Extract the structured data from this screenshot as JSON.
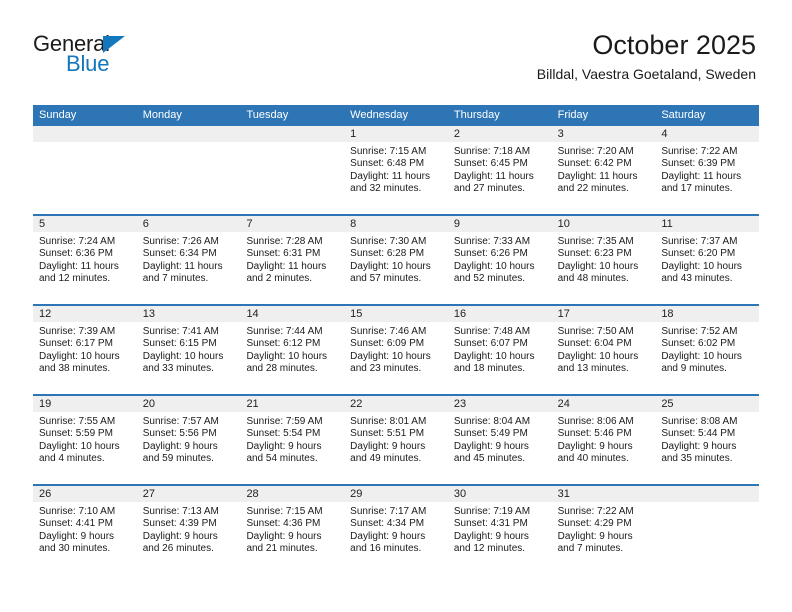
{
  "brand": {
    "word_one": "General",
    "word_two": "Blue",
    "accent_color": "#1277bc"
  },
  "header": {
    "title": "October 2025",
    "subtitle": "Billdal, Vaestra Goetaland, Sweden"
  },
  "theme": {
    "header_blue": "#2e75b6",
    "day_band_grey": "#efefef",
    "text_color": "#1b1b1b"
  },
  "weekday_headers": [
    "Sunday",
    "Monday",
    "Tuesday",
    "Wednesday",
    "Thursday",
    "Friday",
    "Saturday"
  ],
  "weeks": [
    [
      {
        "day": "",
        "lines": [
          "",
          "",
          "",
          ""
        ]
      },
      {
        "day": "",
        "lines": [
          "",
          "",
          "",
          ""
        ]
      },
      {
        "day": "",
        "lines": [
          "",
          "",
          "",
          ""
        ]
      },
      {
        "day": "1",
        "lines": [
          "Sunrise: 7:15 AM",
          "Sunset: 6:48 PM",
          "Daylight: 11 hours",
          "and 32 minutes."
        ]
      },
      {
        "day": "2",
        "lines": [
          "Sunrise: 7:18 AM",
          "Sunset: 6:45 PM",
          "Daylight: 11 hours",
          "and 27 minutes."
        ]
      },
      {
        "day": "3",
        "lines": [
          "Sunrise: 7:20 AM",
          "Sunset: 6:42 PM",
          "Daylight: 11 hours",
          "and 22 minutes."
        ]
      },
      {
        "day": "4",
        "lines": [
          "Sunrise: 7:22 AM",
          "Sunset: 6:39 PM",
          "Daylight: 11 hours",
          "and 17 minutes."
        ]
      }
    ],
    [
      {
        "day": "5",
        "lines": [
          "Sunrise: 7:24 AM",
          "Sunset: 6:36 PM",
          "Daylight: 11 hours",
          "and 12 minutes."
        ]
      },
      {
        "day": "6",
        "lines": [
          "Sunrise: 7:26 AM",
          "Sunset: 6:34 PM",
          "Daylight: 11 hours",
          "and 7 minutes."
        ]
      },
      {
        "day": "7",
        "lines": [
          "Sunrise: 7:28 AM",
          "Sunset: 6:31 PM",
          "Daylight: 11 hours",
          "and 2 minutes."
        ]
      },
      {
        "day": "8",
        "lines": [
          "Sunrise: 7:30 AM",
          "Sunset: 6:28 PM",
          "Daylight: 10 hours",
          "and 57 minutes."
        ]
      },
      {
        "day": "9",
        "lines": [
          "Sunrise: 7:33 AM",
          "Sunset: 6:26 PM",
          "Daylight: 10 hours",
          "and 52 minutes."
        ]
      },
      {
        "day": "10",
        "lines": [
          "Sunrise: 7:35 AM",
          "Sunset: 6:23 PM",
          "Daylight: 10 hours",
          "and 48 minutes."
        ]
      },
      {
        "day": "11",
        "lines": [
          "Sunrise: 7:37 AM",
          "Sunset: 6:20 PM",
          "Daylight: 10 hours",
          "and 43 minutes."
        ]
      }
    ],
    [
      {
        "day": "12",
        "lines": [
          "Sunrise: 7:39 AM",
          "Sunset: 6:17 PM",
          "Daylight: 10 hours",
          "and 38 minutes."
        ]
      },
      {
        "day": "13",
        "lines": [
          "Sunrise: 7:41 AM",
          "Sunset: 6:15 PM",
          "Daylight: 10 hours",
          "and 33 minutes."
        ]
      },
      {
        "day": "14",
        "lines": [
          "Sunrise: 7:44 AM",
          "Sunset: 6:12 PM",
          "Daylight: 10 hours",
          "and 28 minutes."
        ]
      },
      {
        "day": "15",
        "lines": [
          "Sunrise: 7:46 AM",
          "Sunset: 6:09 PM",
          "Daylight: 10 hours",
          "and 23 minutes."
        ]
      },
      {
        "day": "16",
        "lines": [
          "Sunrise: 7:48 AM",
          "Sunset: 6:07 PM",
          "Daylight: 10 hours",
          "and 18 minutes."
        ]
      },
      {
        "day": "17",
        "lines": [
          "Sunrise: 7:50 AM",
          "Sunset: 6:04 PM",
          "Daylight: 10 hours",
          "and 13 minutes."
        ]
      },
      {
        "day": "18",
        "lines": [
          "Sunrise: 7:52 AM",
          "Sunset: 6:02 PM",
          "Daylight: 10 hours",
          "and 9 minutes."
        ]
      }
    ],
    [
      {
        "day": "19",
        "lines": [
          "Sunrise: 7:55 AM",
          "Sunset: 5:59 PM",
          "Daylight: 10 hours",
          "and 4 minutes."
        ]
      },
      {
        "day": "20",
        "lines": [
          "Sunrise: 7:57 AM",
          "Sunset: 5:56 PM",
          "Daylight: 9 hours",
          "and 59 minutes."
        ]
      },
      {
        "day": "21",
        "lines": [
          "Sunrise: 7:59 AM",
          "Sunset: 5:54 PM",
          "Daylight: 9 hours",
          "and 54 minutes."
        ]
      },
      {
        "day": "22",
        "lines": [
          "Sunrise: 8:01 AM",
          "Sunset: 5:51 PM",
          "Daylight: 9 hours",
          "and 49 minutes."
        ]
      },
      {
        "day": "23",
        "lines": [
          "Sunrise: 8:04 AM",
          "Sunset: 5:49 PM",
          "Daylight: 9 hours",
          "and 45 minutes."
        ]
      },
      {
        "day": "24",
        "lines": [
          "Sunrise: 8:06 AM",
          "Sunset: 5:46 PM",
          "Daylight: 9 hours",
          "and 40 minutes."
        ]
      },
      {
        "day": "25",
        "lines": [
          "Sunrise: 8:08 AM",
          "Sunset: 5:44 PM",
          "Daylight: 9 hours",
          "and 35 minutes."
        ]
      }
    ],
    [
      {
        "day": "26",
        "lines": [
          "Sunrise: 7:10 AM",
          "Sunset: 4:41 PM",
          "Daylight: 9 hours",
          "and 30 minutes."
        ]
      },
      {
        "day": "27",
        "lines": [
          "Sunrise: 7:13 AM",
          "Sunset: 4:39 PM",
          "Daylight: 9 hours",
          "and 26 minutes."
        ]
      },
      {
        "day": "28",
        "lines": [
          "Sunrise: 7:15 AM",
          "Sunset: 4:36 PM",
          "Daylight: 9 hours",
          "and 21 minutes."
        ]
      },
      {
        "day": "29",
        "lines": [
          "Sunrise: 7:17 AM",
          "Sunset: 4:34 PM",
          "Daylight: 9 hours",
          "and 16 minutes."
        ]
      },
      {
        "day": "30",
        "lines": [
          "Sunrise: 7:19 AM",
          "Sunset: 4:31 PM",
          "Daylight: 9 hours",
          "and 12 minutes."
        ]
      },
      {
        "day": "31",
        "lines": [
          "Sunrise: 7:22 AM",
          "Sunset: 4:29 PM",
          "Daylight: 9 hours",
          "and 7 minutes."
        ]
      },
      {
        "day": "",
        "lines": [
          "",
          "",
          "",
          ""
        ]
      }
    ]
  ]
}
